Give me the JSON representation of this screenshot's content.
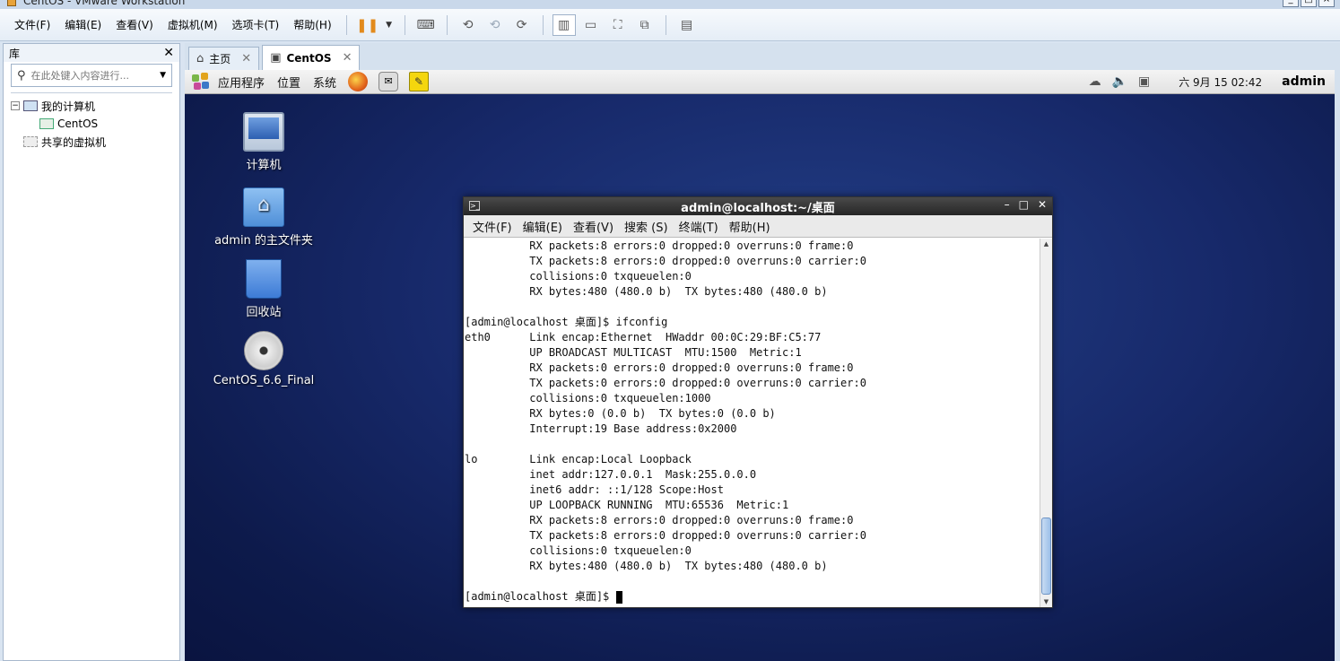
{
  "window": {
    "title": "CentOS - VMware Workstation"
  },
  "menubar": {
    "items": [
      "文件(F)",
      "编辑(E)",
      "查看(V)",
      "虚拟机(M)",
      "选项卡(T)",
      "帮助(H)"
    ]
  },
  "library": {
    "title": "库",
    "search_placeholder": "在此处键入内容进行...",
    "tree": {
      "root": "我的计算机",
      "vm": "CentOS",
      "shared": "共享的虚拟机"
    }
  },
  "tabs": [
    {
      "label": "主页",
      "active": false
    },
    {
      "label": "CentOS",
      "active": true
    }
  ],
  "guest_panel": {
    "menus": [
      "应用程序",
      "位置",
      "系统"
    ],
    "clock": "六 9月 15 02:42",
    "user": "admin"
  },
  "desktop_icons": [
    {
      "label": "计算机",
      "icon": "computer-icon"
    },
    {
      "label": "admin 的主文件夹",
      "icon": "home-folder-icon"
    },
    {
      "label": "回收站",
      "icon": "trash-icon"
    },
    {
      "label": "CentOS_6.6_Final",
      "icon": "dvd-icon"
    }
  ],
  "terminal": {
    "title": "admin@localhost:~/桌面",
    "menus": [
      "文件(F)",
      "编辑(E)",
      "查看(V)",
      "搜索 (S)",
      "终端(T)",
      "帮助(H)"
    ],
    "lines": [
      "          RX packets:8 errors:0 dropped:0 overruns:0 frame:0",
      "          TX packets:8 errors:0 dropped:0 overruns:0 carrier:0",
      "          collisions:0 txqueuelen:0",
      "          RX bytes:480 (480.0 b)  TX bytes:480 (480.0 b)",
      "",
      "[admin@localhost 桌面]$ ifconfig",
      "eth0      Link encap:Ethernet  HWaddr 00:0C:29:BF:C5:77",
      "          UP BROADCAST MULTICAST  MTU:1500  Metric:1",
      "          RX packets:0 errors:0 dropped:0 overruns:0 frame:0",
      "          TX packets:0 errors:0 dropped:0 overruns:0 carrier:0",
      "          collisions:0 txqueuelen:1000",
      "          RX bytes:0 (0.0 b)  TX bytes:0 (0.0 b)",
      "          Interrupt:19 Base address:0x2000",
      "",
      "lo        Link encap:Local Loopback",
      "          inet addr:127.0.0.1  Mask:255.0.0.0",
      "          inet6 addr: ::1/128 Scope:Host",
      "          UP LOOPBACK RUNNING  MTU:65536  Metric:1",
      "          RX packets:8 errors:0 dropped:0 overruns:0 frame:0",
      "          TX packets:8 errors:0 dropped:0 overruns:0 carrier:0",
      "          collisions:0 txqueuelen:0",
      "          RX bytes:480 (480.0 b)  TX bytes:480 (480.0 b)",
      ""
    ],
    "prompt": "[admin@localhost 桌面]$ "
  },
  "colors": {
    "desktop": "#17296a",
    "accent": "#e28a1c"
  }
}
